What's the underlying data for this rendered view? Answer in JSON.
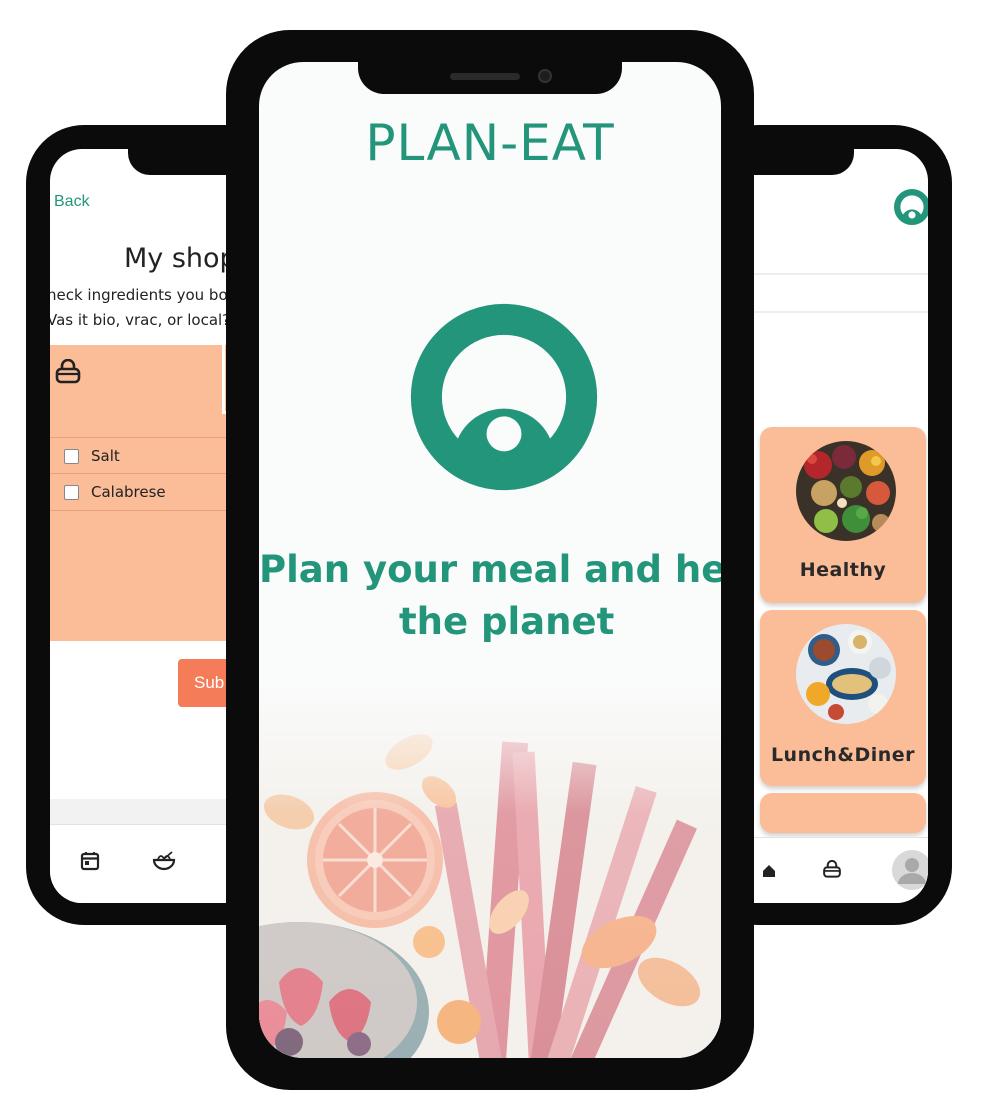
{
  "brand": "PLAN-EAT",
  "tagline": {
    "line1": "Plan your meal and hel",
    "line2": "the planet"
  },
  "left_screen": {
    "back_label": "Back",
    "title": "My shop",
    "instructions": [
      "heck ingredients you bou",
      "Vas it bio, vrac, or local?"
    ],
    "ingredients": [
      "Salt",
      "Calabrese"
    ],
    "submit_label": "Sub"
  },
  "right_screen": {
    "categories": [
      "Healthy",
      "Lunch&Diner"
    ]
  },
  "icons": {
    "basket": "basket-icon",
    "calendar": "calendar-icon",
    "bowl": "bowl-icon",
    "home": "home-icon",
    "avatar": "avatar-icon",
    "logo": "plan-eat-logo-icon"
  },
  "colors": {
    "brand_green": "#23957a",
    "panel_peach": "#fbbd98",
    "button_orange": "#f47c58"
  }
}
